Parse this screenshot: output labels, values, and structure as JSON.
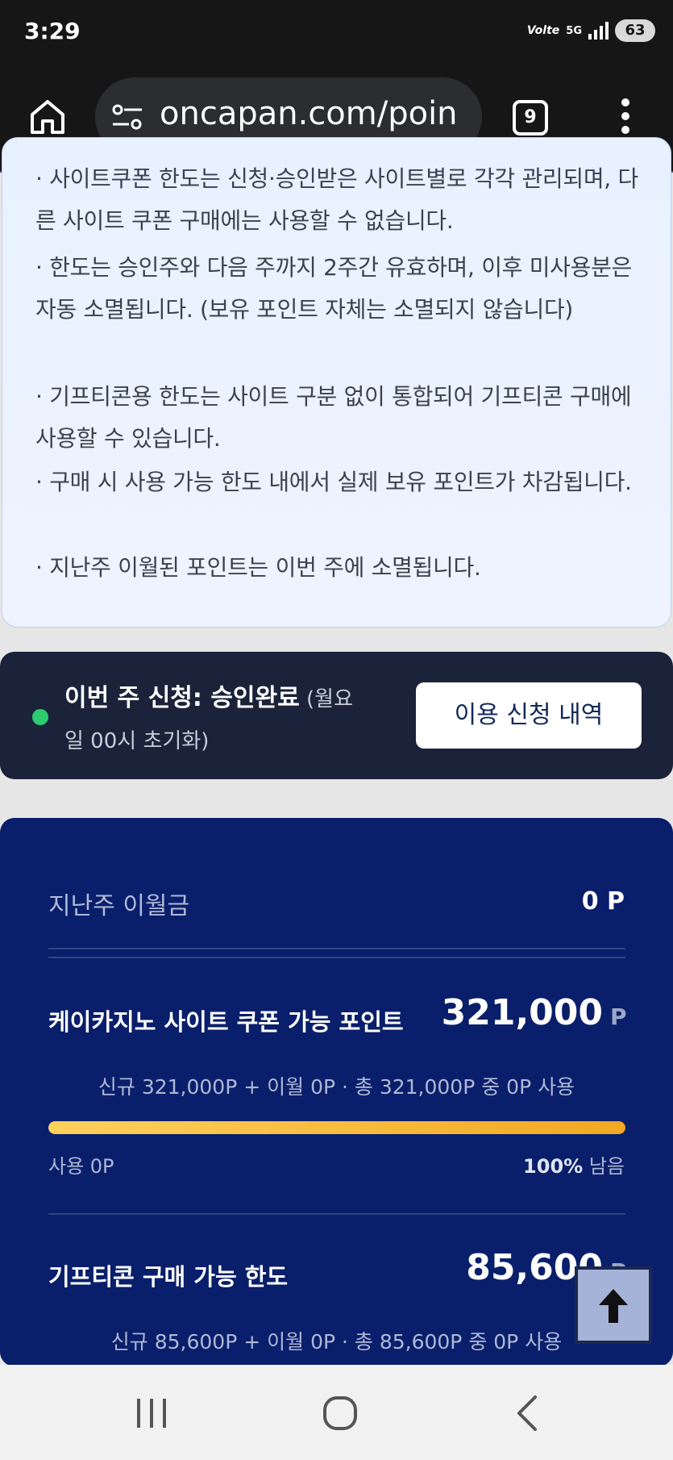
{
  "status_bar": {
    "time": "3:29",
    "volte": "Volte",
    "network": "5G",
    "battery": "63"
  },
  "browser": {
    "url": "oncapan.com/poin",
    "tab_count": "9"
  },
  "notice": {
    "items": [
      "· 사이트쿠폰 한도는 신청·승인받은 사이트별로 각각 관리되며, 다른 사이트 쿠폰 구매에는 사용할 수 없습니다.",
      "· 한도는 승인주와 다음 주까지 2주간 유효하며, 이후 미사용분은 자동 소멸됩니다. (보유 포인트 자체는 소멸되지 않습니다)",
      "· 기프티콘용 한도는 사이트 구분 없이 통합되어 기프티콘 구매에 사용할 수 있습니다.",
      "· 구매 시 사용 가능 한도 내에서 실제 보유 포인트가 차감됩니다.",
      "· 지난주 이월된 포인트는 이번 주에 소멸됩니다."
    ]
  },
  "apply_status": {
    "label": "이번 주 신청: 승인완료",
    "note": " (월요일 00시 초기화)",
    "dot_color": "#2ecc71",
    "button_label": "이용 신청 내역"
  },
  "points": {
    "carryover_label": "지난주 이월금",
    "carryover_value": "0 P",
    "site_coupon": {
      "label": "케이카지노 사이트 쿠폰 가능 포인트",
      "value": "321,000",
      "unit": "P",
      "desc": "신규 321,000P + 이월 0P · 총 321,000P 중 0P 사용",
      "used_label": "사용 0P",
      "remaining_pct": "100%",
      "remaining_label": " 남음",
      "remaining_fraction": 1.0
    },
    "gifticon": {
      "label": "기프티콘 구매 가능 한도",
      "value": "85,600",
      "unit": "P",
      "desc": "신규 85,600P + 이월 0P · 총 85,600P 중 0P 사용"
    }
  },
  "icons": {
    "home": "home-icon",
    "site_settings": "tune-icon",
    "tabs": "tabs-icon",
    "menu": "more-vert-icon",
    "scroll_top": "arrow-up-icon",
    "nav_recents": "recents-icon",
    "nav_home": "home-circle-icon",
    "nav_back": "back-icon"
  },
  "colors": {
    "card_bg": "#0a1f6b",
    "accent": "#f2a821",
    "status_dark": "#1a233a"
  }
}
